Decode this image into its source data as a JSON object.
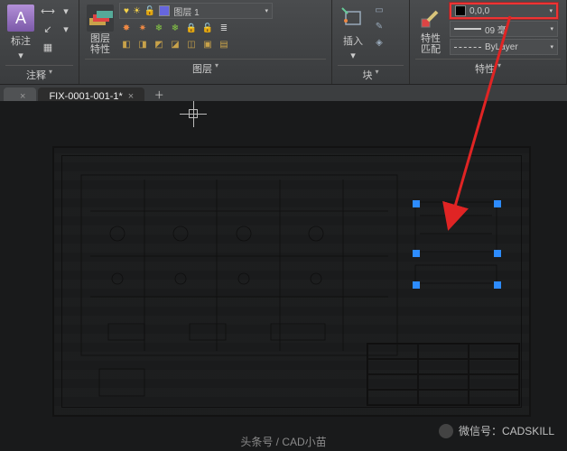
{
  "ribbon": {
    "annotate": {
      "label": "标注",
      "title": "注释"
    },
    "layers": {
      "big_label": "图层\n特性",
      "layer_combo": "图层 1",
      "title": "图层"
    },
    "blocks": {
      "big_label": "插入",
      "title": "块"
    },
    "properties": {
      "big_label": "特性\n匹配",
      "color_combo": "0,0,0",
      "lineweight_combo": "09 毫",
      "linetype_combo": "ByLayer",
      "title": "特性"
    }
  },
  "tabs": {
    "first": "",
    "second": "FIX-0001-001-1*"
  },
  "colors": {
    "highlight": "#e02424",
    "grip": "#2d8cff",
    "black_swatch": "#000000"
  },
  "watermark": {
    "label": "微信号：CADSKILL"
  },
  "source": {
    "label": "头条号 / CAD小苗"
  }
}
